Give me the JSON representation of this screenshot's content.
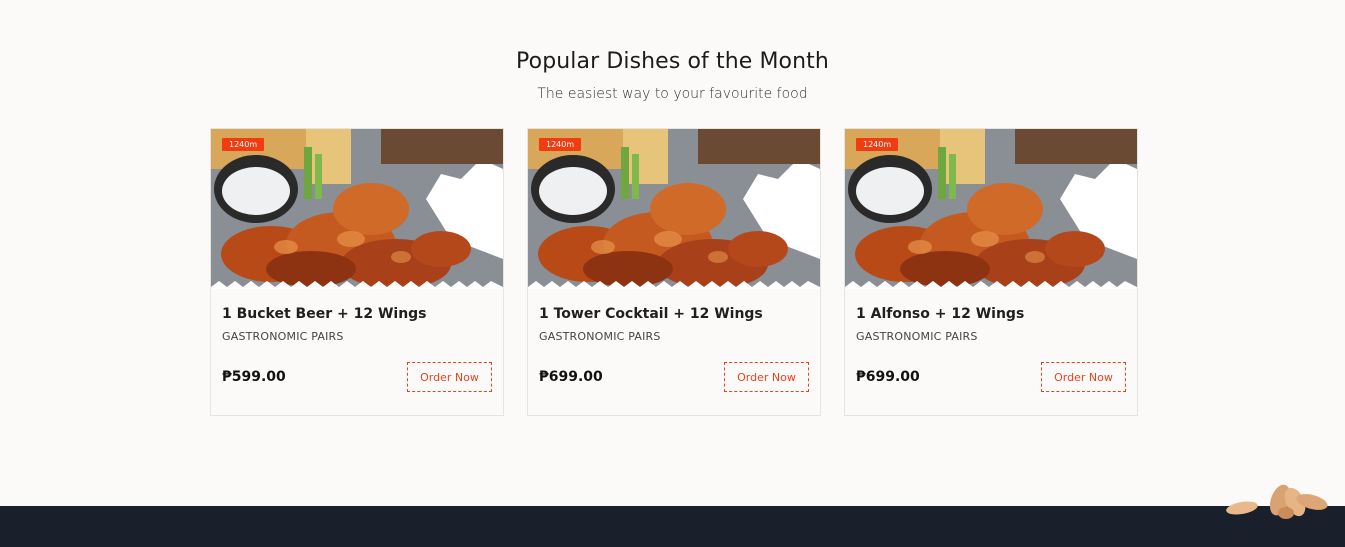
{
  "section": {
    "title": "Popular Dishes of the Month",
    "subtitle": "The easiest way to your favourite food"
  },
  "cards": [
    {
      "badge": "1240m",
      "name": "1 Bucket Beer + 12 Wings",
      "category": "GASTRONOMIC PAIRS",
      "price": "₱599.00",
      "button": "Order Now"
    },
    {
      "badge": "1240m",
      "name": "1 Tower Cocktail + 12 Wings",
      "category": "GASTRONOMIC PAIRS",
      "price": "₱699.00",
      "button": "Order Now"
    },
    {
      "badge": "1240m",
      "name": "1 Alfonso + 12 Wings",
      "category": "GASTRONOMIC PAIRS",
      "price": "₱699.00",
      "button": "Order Now"
    }
  ],
  "colors": {
    "accent": "#e64420",
    "badge": "#f03c10",
    "footer": "#1a1f2c",
    "background": "#fbfaf8"
  },
  "icons": {
    "dish_image": "chicken-wings-photo",
    "footer_decoration": "almond-leaves-icon"
  }
}
